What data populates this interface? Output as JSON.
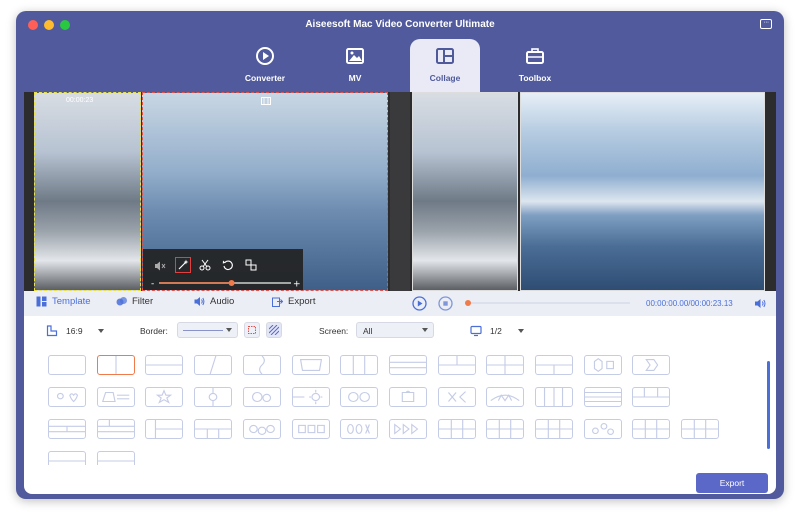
{
  "window": {
    "title": "Aiseesoft Mac Video Converter Ultimate"
  },
  "icons": {
    "chat": "chat-icon",
    "template": "template-icon",
    "filter": "filter-icon",
    "audio": "audio-icon",
    "export": "export-icon"
  },
  "nav": {
    "tabs": [
      {
        "label": "Converter",
        "icon": "converter-icon"
      },
      {
        "label": "MV",
        "icon": "mv-icon"
      },
      {
        "label": "Collage",
        "icon": "collage-icon",
        "active": true
      },
      {
        "label": "Toolbox",
        "icon": "toolbox-icon"
      }
    ]
  },
  "preview": {
    "left_cell_time": "00:00:23",
    "edit_volume": 0.55
  },
  "player": {
    "time": "00:00:00.00/00:00:23.13",
    "progress": 0.0
  },
  "tools": {
    "template": "Template",
    "filter": "Filter",
    "audio": "Audio",
    "export": "Export"
  },
  "options": {
    "ratio": "16:9",
    "border_label": "Border:",
    "screen_label": "Screen:",
    "screen_value": "All",
    "page": "1/2"
  },
  "colors": {
    "accent": "#4a6fd8",
    "window_frame": "#505a9c",
    "selection": "#f07a4a",
    "export_button": "#5b68c8"
  },
  "export_button": "Export"
}
